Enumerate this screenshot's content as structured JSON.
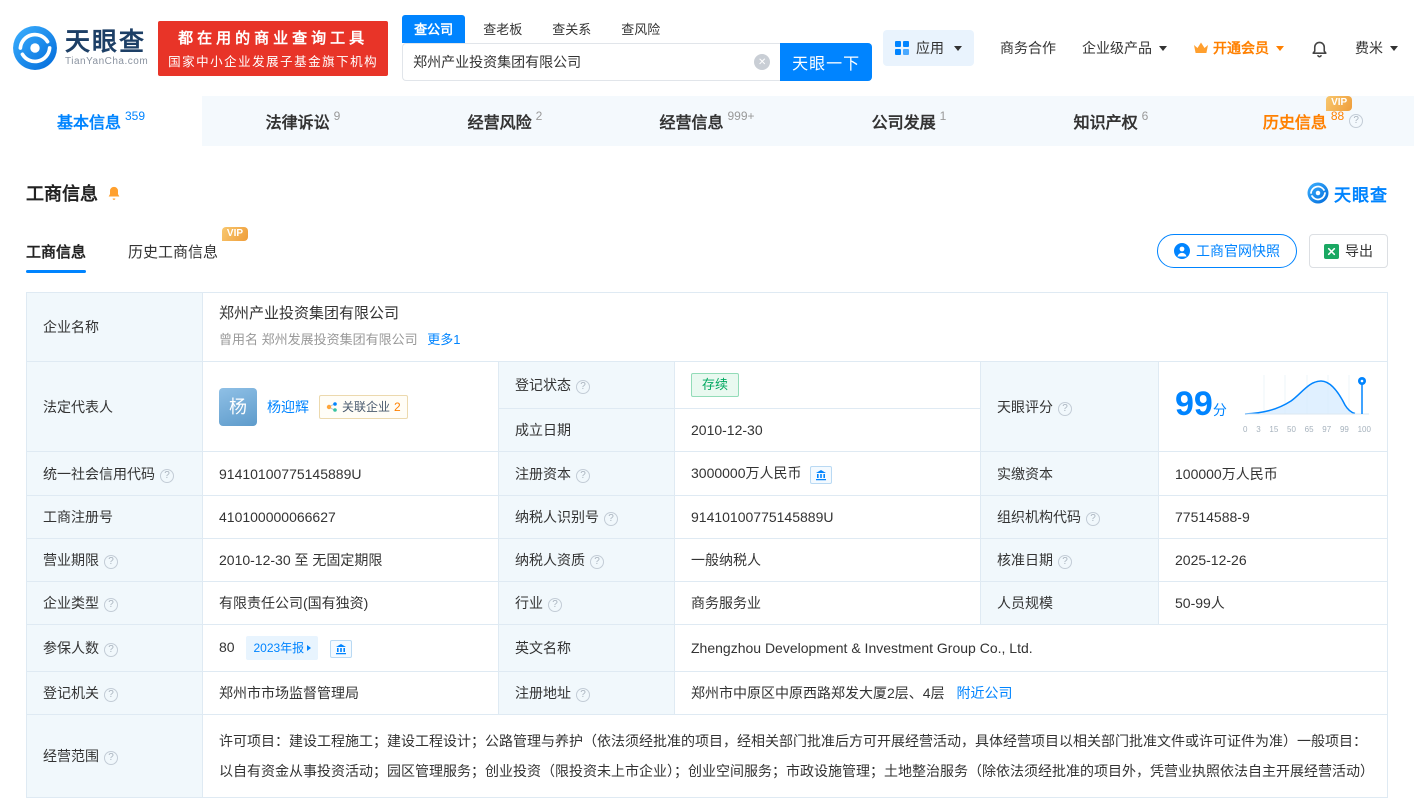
{
  "header": {
    "logo": {
      "name": "天眼查",
      "domain": "TianYanCha.com"
    },
    "promo": {
      "line1": "都在用的商业查询工具",
      "line2": "国家中小企业发展子基金旗下机构"
    },
    "search": {
      "tabs": [
        {
          "label": "查公司"
        },
        {
          "label": "查老板"
        },
        {
          "label": "查关系"
        },
        {
          "label": "查风险"
        }
      ],
      "value": "郑州产业投资集团有限公司",
      "button": "天眼一下"
    },
    "nav": {
      "apps": "应用",
      "cooperation": "商务合作",
      "enterprise_products": "企业级产品",
      "vip": "开通会员",
      "username": "费米"
    }
  },
  "tabs": [
    {
      "label": "基本信息",
      "count": "359"
    },
    {
      "label": "法律诉讼",
      "count": "9"
    },
    {
      "label": "经营风险",
      "count": "2"
    },
    {
      "label": "经营信息",
      "count": "999+"
    },
    {
      "label": "公司发展",
      "count": "1"
    },
    {
      "label": "知识产权",
      "count": "6"
    },
    {
      "label": "历史信息",
      "count": "88",
      "vip": "VIP"
    }
  ],
  "section": {
    "title": "工商信息",
    "brand": "天眼查",
    "subtabs": [
      {
        "label": "工商信息"
      },
      {
        "label": "历史工商信息",
        "vip": "VIP"
      }
    ],
    "snapshot_button": "工商官网快照",
    "export_button": "导出"
  },
  "fields": {
    "company_name": {
      "label": "企业名称",
      "value": "郑州产业投资集团有限公司"
    },
    "former_name": {
      "label": "曾用名",
      "value": "郑州发展投资集团有限公司",
      "more": "更多1"
    },
    "legal_rep": {
      "label": "法定代表人",
      "avatar": "杨",
      "name": "杨迎辉",
      "tag": "关联企业",
      "tag_count": "2"
    },
    "reg_status": {
      "label": "登记状态",
      "value": "存续"
    },
    "est_date": {
      "label": "成立日期",
      "value": "2010-12-30"
    },
    "score": {
      "label": "天眼评分",
      "value": "99",
      "unit": "分",
      "axis": [
        "0",
        "3",
        "15",
        "50",
        "65",
        "97",
        "99",
        "100"
      ]
    },
    "credit_code": {
      "label": "统一社会信用代码",
      "value": "91410100775145889U"
    },
    "reg_capital": {
      "label": "注册资本",
      "value": "3000000万人民币"
    },
    "paid_capital": {
      "label": "实缴资本",
      "value": "100000万人民币"
    },
    "reg_number": {
      "label": "工商注册号",
      "value": "410100000066627"
    },
    "taxpayer_id": {
      "label": "纳税人识别号",
      "value": "91410100775145889U"
    },
    "org_code": {
      "label": "组织机构代码",
      "value": "77514588-9"
    },
    "business_term": {
      "label": "营业期限",
      "value": "2010-12-30 至 无固定期限"
    },
    "taxpayer_quality": {
      "label": "纳税人资质",
      "value": "一般纳税人"
    },
    "approval_date": {
      "label": "核准日期",
      "value": "2025-12-26"
    },
    "company_type": {
      "label": "企业类型",
      "value": "有限责任公司(国有独资)"
    },
    "industry": {
      "label": "行业",
      "value": "商务服务业"
    },
    "staff_size": {
      "label": "人员规模",
      "value": "50-99人"
    },
    "insured_count": {
      "label": "参保人数",
      "value": "80",
      "tag": "2023年报"
    },
    "english_name": {
      "label": "英文名称",
      "value": "Zhengzhou Development & Investment Group Co., Ltd."
    },
    "reg_authority": {
      "label": "登记机关",
      "value": "郑州市市场监督管理局"
    },
    "address": {
      "label": "注册地址",
      "value": "郑州市中原区中原西路郑发大厦2层、4层",
      "link": "附近公司"
    },
    "business_scope": {
      "label": "经营范围",
      "value": "许可项目：建设工程施工；建设工程设计；公路管理与养护（依法须经批准的项目，经相关部门批准后方可开展经营活动，具体经营项目以相关部门批准文件或许可证件为准）一般项目：以自有资金从事投资活动；园区管理服务；创业投资（限投资未上市企业）；创业空间服务；市政设施管理；土地整治服务（除依法须经批准的项目外，凭营业执照依法自主开展经营活动）"
    }
  },
  "colors": {
    "brand_blue": "#0084ff",
    "vip_orange": "#ff8000",
    "promo_red": "#e83428",
    "status_green": "#00a860"
  }
}
